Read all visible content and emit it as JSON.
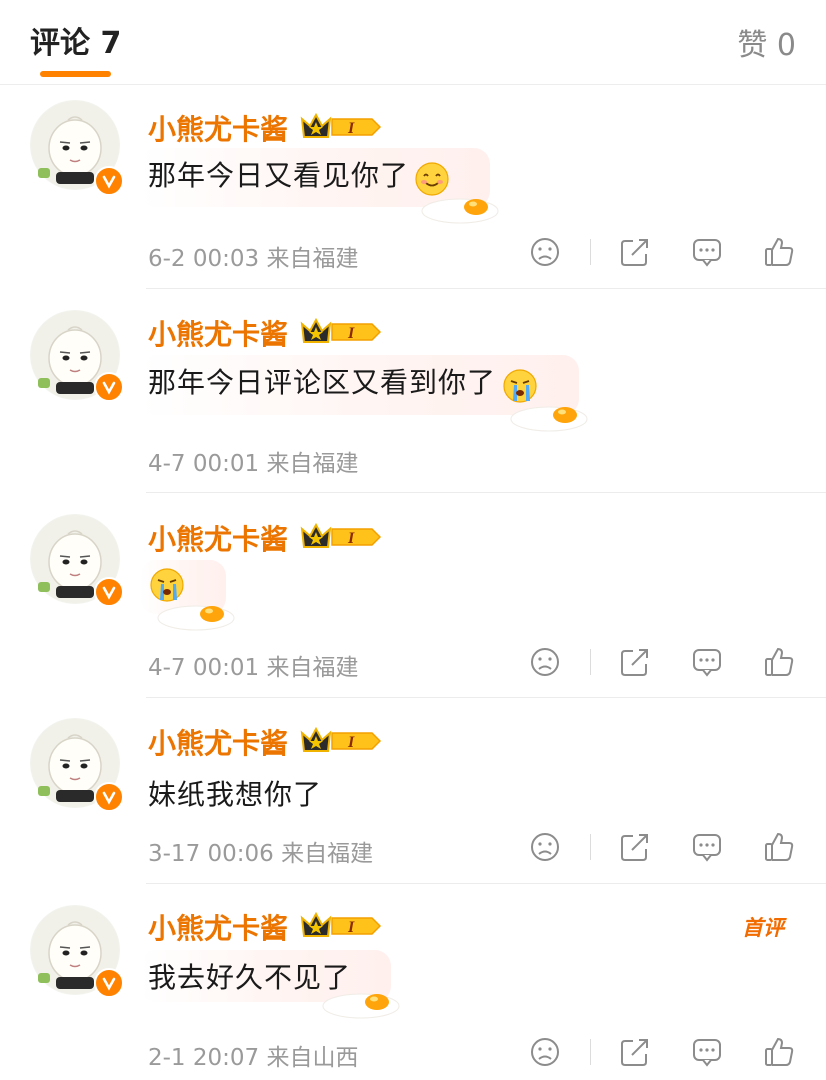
{
  "header": {
    "comments_tab": "评论 7",
    "likes_tab": "赞 0",
    "accent": "#ff8200"
  },
  "comments": [
    {
      "author": "小熊尤卡酱",
      "text": "那年今日又看见你了",
      "emoji": "smile-face",
      "meta": "6-2 00:03 来自福建",
      "badge": "crown-level-I",
      "first_tag": ""
    },
    {
      "author": "小熊尤卡酱",
      "text": "那年今日评论区又看到你了",
      "emoji": "crying-face",
      "meta": "4-7 00:01 来自福建",
      "badge": "crown-level-I",
      "first_tag": ""
    },
    {
      "author": "小熊尤卡酱",
      "text": "",
      "emoji": "crying-face",
      "meta": "4-7 00:01 来自福建",
      "badge": "crown-level-I",
      "first_tag": ""
    },
    {
      "author": "小熊尤卡酱",
      "text": "妹纸我想你了",
      "emoji": "",
      "meta": "3-17 00:06 来自福建",
      "badge": "crown-level-I",
      "first_tag": ""
    },
    {
      "author": "小熊尤卡酱",
      "text": "我去好久不见了",
      "emoji": "",
      "meta": "2-1 20:07 来自山西",
      "badge": "crown-level-I",
      "first_tag": "首评"
    }
  ],
  "badge_label": "I",
  "icons": [
    "dislike-icon",
    "share-icon",
    "comment-icon",
    "like-icon"
  ]
}
